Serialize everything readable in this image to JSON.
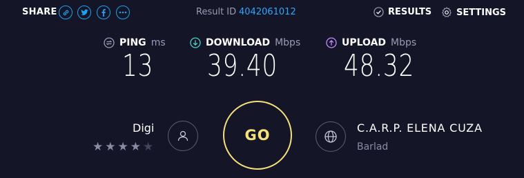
{
  "header": {
    "share_label": "SHARE",
    "share_icons": [
      "link-icon",
      "twitter-icon",
      "facebook-icon",
      "more-icon"
    ],
    "result_label": "Result ID",
    "result_id": "4042061012",
    "results_label": "RESULTS",
    "settings_label": "SETTINGS"
  },
  "metrics": {
    "ping": {
      "label": "PING",
      "unit": "ms",
      "value": "13",
      "icon": "ping-icon"
    },
    "download": {
      "label": "DOWNLOAD",
      "unit": "Mbps",
      "value": "39.40",
      "icon": "download-icon"
    },
    "upload": {
      "label": "UPLOAD",
      "unit": "Mbps",
      "value": "48.32",
      "icon": "upload-icon"
    }
  },
  "provider": {
    "name": "Digi",
    "rating": 4,
    "max_rating": 5
  },
  "go_label": "GO",
  "server": {
    "name": "C.A.R.P. ELENA CUZA",
    "location": "Barlad"
  },
  "colors": {
    "background": "#141526",
    "accent_blue": "#1da1f2",
    "download": "#4fd1c5",
    "upload": "#c78cff",
    "go": "#f5e27a"
  }
}
